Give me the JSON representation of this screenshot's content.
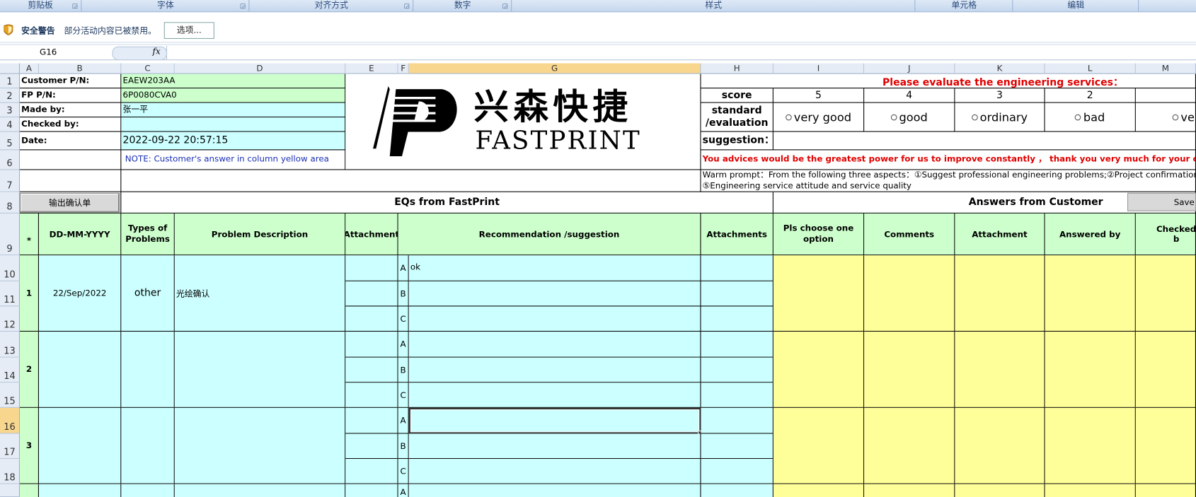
{
  "ribbon": {
    "groups": [
      "剪贴板",
      "字体",
      "对齐方式",
      "数字",
      "样式",
      "单元格",
      "编辑"
    ]
  },
  "security": {
    "title": "安全警告",
    "message": "部分活动内容已被禁用。",
    "options_button": "选项..."
  },
  "formula_bar": {
    "name_box": "G16",
    "fx": "fx",
    "formula": ""
  },
  "columns": [
    "A",
    "B",
    "C",
    "D",
    "E",
    "F",
    "G",
    "H",
    "I",
    "J",
    "K",
    "L",
    "M"
  ],
  "rows": [
    "1",
    "2",
    "3",
    "4",
    "5",
    "6",
    "7",
    "8",
    "9",
    "10",
    "11",
    "12",
    "13",
    "14",
    "15",
    "16",
    "17",
    "18"
  ],
  "selected_cell": "G16",
  "header": {
    "customer_pn_label": "Customer P/N:",
    "customer_pn": "EAEW203AA",
    "fp_pn_label": "FP P/N:",
    "fp_pn": "6P0080CVA0",
    "made_by_label": "Made by:",
    "made_by": "张一平",
    "checked_by_label": "Checked by:",
    "checked_by": "",
    "date_label": "Date:",
    "date": "2022-09-22 20:57:15",
    "note": "NOTE: Customer's  answer in column yellow area"
  },
  "logo": {
    "cn": "兴森快捷",
    "en": "FASTPRINT"
  },
  "evaluation": {
    "title": "Please evaluate the engineering services：",
    "score_label": "score",
    "scores": [
      "5",
      "4",
      "3",
      "2"
    ],
    "standard_label": "standard /evaluation",
    "options": [
      "very good",
      "good",
      "ordinary",
      "bad",
      "ve"
    ],
    "suggestion_label": "suggestion：",
    "advice": "You advices would be the greatest power for us to improve constantly ，  thank you very much for your cooperation!",
    "warm_prompt_1": "Warm prompt：From the following three aspects：①Suggest professional engineering problems;②Project confirmation timely;",
    "warm_prompt_2": "⑤Engineering service attitude and service quality"
  },
  "buttons": {
    "export": "输出确认单",
    "save": "Save"
  },
  "sections": {
    "eqs": "EQs from FastPrint",
    "answers": "Answers from Customer"
  },
  "table_headers": {
    "idx": "*",
    "date": "DD-MM-YYYY",
    "types": "Types of Problems",
    "desc": "Problem Description",
    "attachment": "Attachment",
    "recommendation": "Recommendation /suggestion",
    "attachments": "Attachments",
    "choose": "Pls choose one option",
    "comments": "Comments",
    "attachment2": "Attachment",
    "answered_by": "Answered by",
    "checked_by": "Checked b"
  },
  "entries": [
    {
      "num": "1",
      "date": "22/Sep/2022",
      "type": "other",
      "desc": "光绘确认",
      "letters": [
        "A",
        "B",
        "C"
      ],
      "recs": [
        "ok",
        "",
        ""
      ]
    },
    {
      "num": "2",
      "date": "",
      "type": "",
      "desc": "",
      "letters": [
        "A",
        "B",
        "C"
      ],
      "recs": [
        "",
        "",
        ""
      ]
    },
    {
      "num": "3",
      "date": "",
      "type": "",
      "desc": "",
      "letters": [
        "A",
        "B",
        "C"
      ],
      "recs": [
        "",
        "",
        ""
      ]
    },
    {
      "num": "",
      "date": "",
      "type": "",
      "desc": "",
      "letters": [
        "A"
      ],
      "recs": [
        ""
      ]
    }
  ],
  "colors": {
    "green": "#ccffcc",
    "cyan": "#ccffff",
    "yellow": "#ffff99",
    "red": "#e00000",
    "ribbon": "#c5d7ee",
    "selected_header": "#f9d68e"
  }
}
